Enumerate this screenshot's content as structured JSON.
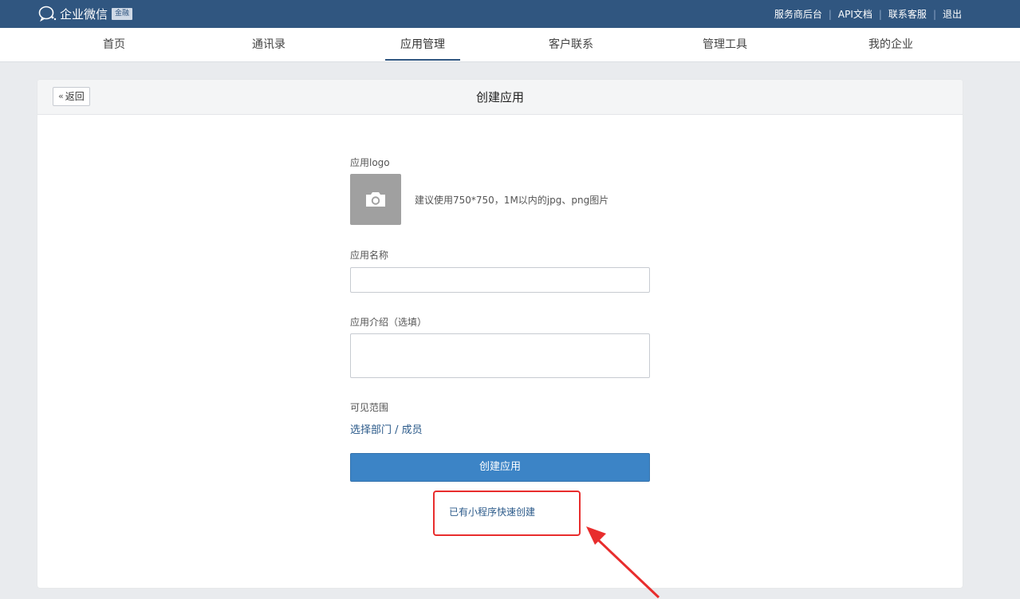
{
  "header": {
    "brand_name": "企业微信",
    "brand_badge": "金融",
    "links": [
      "服务商后台",
      "API文档",
      "联系客服",
      "退出"
    ]
  },
  "nav": {
    "items": [
      "首页",
      "通讯录",
      "应用管理",
      "客户联系",
      "管理工具",
      "我的企业"
    ],
    "active": "应用管理"
  },
  "page": {
    "back_label": "返回",
    "title": "创建应用"
  },
  "form": {
    "logo_label": "应用logo",
    "logo_hint": "建议使用750*750，1M以内的jpg、png图片",
    "name_label": "应用名称",
    "name_value": "",
    "intro_label": "应用介绍（选填）",
    "intro_value": "",
    "visibility_label": "可见范围",
    "visibility_link": "选择部门 / 成员",
    "submit_label": "创建应用",
    "quick_create_link": "已有小程序快速创建"
  },
  "colors": {
    "topbar": "#305680",
    "primary_button": "#3c84c6",
    "link": "#2b5a8a",
    "annotation": "#e82d2d"
  },
  "icons": [
    "wechat-work-logo-icon",
    "camera-icon",
    "double-chevron-left-icon",
    "annotation-arrow"
  ]
}
